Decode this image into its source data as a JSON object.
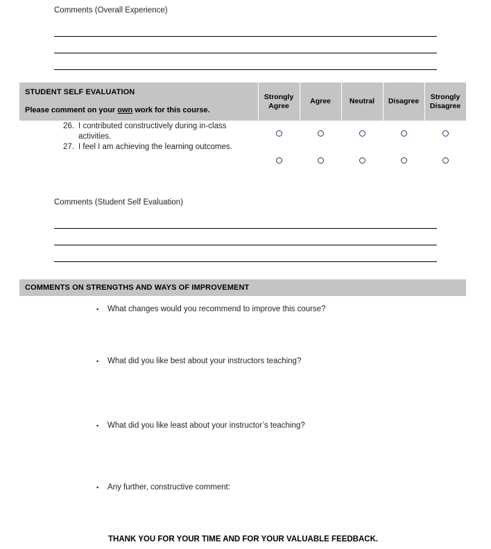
{
  "overall_comments": {
    "label": "Comments (Overall Experience)",
    "line_count": 3
  },
  "self_evaluation": {
    "title": "STUDENT SELF EVALUATION",
    "subtitle_prefix": "Please comment on your ",
    "subtitle_underlined": "own",
    "subtitle_suffix": " work for this course.",
    "scale_headers": [
      "Strongly Agree",
      "Agree",
      "Neutral",
      "Disagree",
      "Strongly Disagree"
    ],
    "questions": [
      {
        "number": "26.",
        "text": "I contributed constructively during in-class activities."
      },
      {
        "number": "27.",
        "text": "I feel I am achieving the learning outcomes."
      }
    ]
  },
  "self_eval_comments": {
    "label": "Comments (Student Self Evaluation)",
    "line_count": 3
  },
  "strengths_section": {
    "heading": "COMMENTS ON STRENGTHS AND WAYS OF IMPROVEMENT",
    "bullet_glyph": "▪",
    "bullets": [
      "What changes would you recommend to improve this course?",
      "What did you like best about your instructors teaching?",
      "What did you like least about your instructor’s teaching?",
      "Any further, constructive comment:"
    ]
  },
  "footer": {
    "thanks": "THANK YOU FOR YOUR TIME AND FOR YOUR VALUABLE FEEDBACK."
  },
  "colors": {
    "grey_bar": "#c4c4c4",
    "text": "#231f20",
    "radio_outline": "#1f3864",
    "rule": "#000000"
  }
}
